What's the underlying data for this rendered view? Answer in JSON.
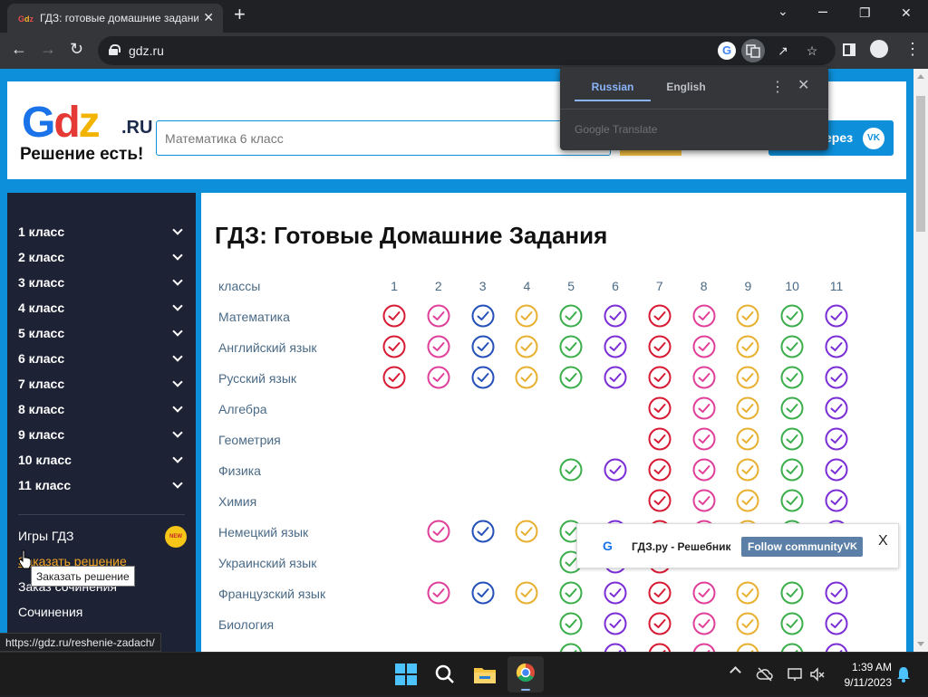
{
  "browser": {
    "tab_title": "ГДЗ: готовые домашние задания",
    "tab_favicon": "G",
    "url": "gdz.ru",
    "new_tab": "+",
    "minimize": "⌄",
    "close": "✕"
  },
  "site": {
    "logo_text": "GDZ",
    "logo_suffix": ".RU",
    "slogan": "Решение есть!",
    "search_placeholder": "Математика 6 класс",
    "vk_login_label": "ерез",
    "vk_icon": "VK"
  },
  "translate_popup": {
    "tab_source": "Russian",
    "tab_target": "English",
    "brand": "Google Translate",
    "menu": "⋮",
    "close": "✕"
  },
  "sidebar": {
    "grades": [
      "1 класс",
      "2 класс",
      "3 класс",
      "4 класс",
      "5 класс",
      "6 класс",
      "7 класс",
      "8 класс",
      "9 класс",
      "10 класс",
      "11 класс"
    ],
    "games_label": "Игры ГДЗ",
    "new_badge": "NEW",
    "order_solution": "Заказать решение",
    "order_essay": "Заказ сочинения",
    "essays": "Сочинения"
  },
  "main": {
    "title": "ГДЗ: Готовые Домашние Задания",
    "grades_header": "классы",
    "columns": [
      "1",
      "2",
      "3",
      "4",
      "5",
      "6",
      "7",
      "8",
      "9",
      "10",
      "11"
    ],
    "column_colors": [
      "#d81b34",
      "#e0409a",
      "#2450b8",
      "#e8b030",
      "#3dae4c",
      "#7b2ed6",
      "#d81b34",
      "#e0409a",
      "#e8b030",
      "#3dae4c",
      "#7b2ed6"
    ],
    "subjects": [
      {
        "name": "Математика",
        "grades": [
          1,
          2,
          3,
          4,
          5,
          6,
          7,
          8,
          9,
          10,
          11
        ]
      },
      {
        "name": "Английский язык",
        "grades": [
          1,
          2,
          3,
          4,
          5,
          6,
          7,
          8,
          9,
          10,
          11
        ]
      },
      {
        "name": "Русский язык",
        "grades": [
          1,
          2,
          3,
          4,
          5,
          6,
          7,
          8,
          9,
          10,
          11
        ]
      },
      {
        "name": "Алгебра",
        "grades": [
          7,
          8,
          9,
          10,
          11
        ]
      },
      {
        "name": "Геометрия",
        "grades": [
          7,
          8,
          9,
          10,
          11
        ]
      },
      {
        "name": "Физика",
        "grades": [
          5,
          6,
          7,
          8,
          9,
          10,
          11
        ]
      },
      {
        "name": "Химия",
        "grades": [
          7,
          8,
          9,
          10,
          11
        ]
      },
      {
        "name": "Немецкий язык",
        "grades": [
          2,
          3,
          4,
          5,
          6,
          7,
          8,
          9,
          10,
          11
        ]
      },
      {
        "name": "Украинский язык",
        "grades": [
          5,
          6,
          7
        ]
      },
      {
        "name": "Французский язык",
        "grades": [
          2,
          3,
          4,
          5,
          6,
          7,
          8,
          9,
          10,
          11
        ]
      },
      {
        "name": "Биология",
        "grades": [
          5,
          6,
          7,
          8,
          9,
          10,
          11
        ]
      },
      {
        "name": "",
        "grades": [
          5,
          6,
          7,
          8,
          9,
          10,
          11
        ]
      }
    ]
  },
  "vk_widget": {
    "community": "ГДЗ.ру - Решебник",
    "follow": "Follow community",
    "vk": "VK",
    "close": "X"
  },
  "tooltip": "Заказать решение",
  "status_url": "https://gdz.ru/reshenie-zadach/",
  "taskbar": {
    "time": "1:39 AM",
    "date": "9/11/2023"
  }
}
